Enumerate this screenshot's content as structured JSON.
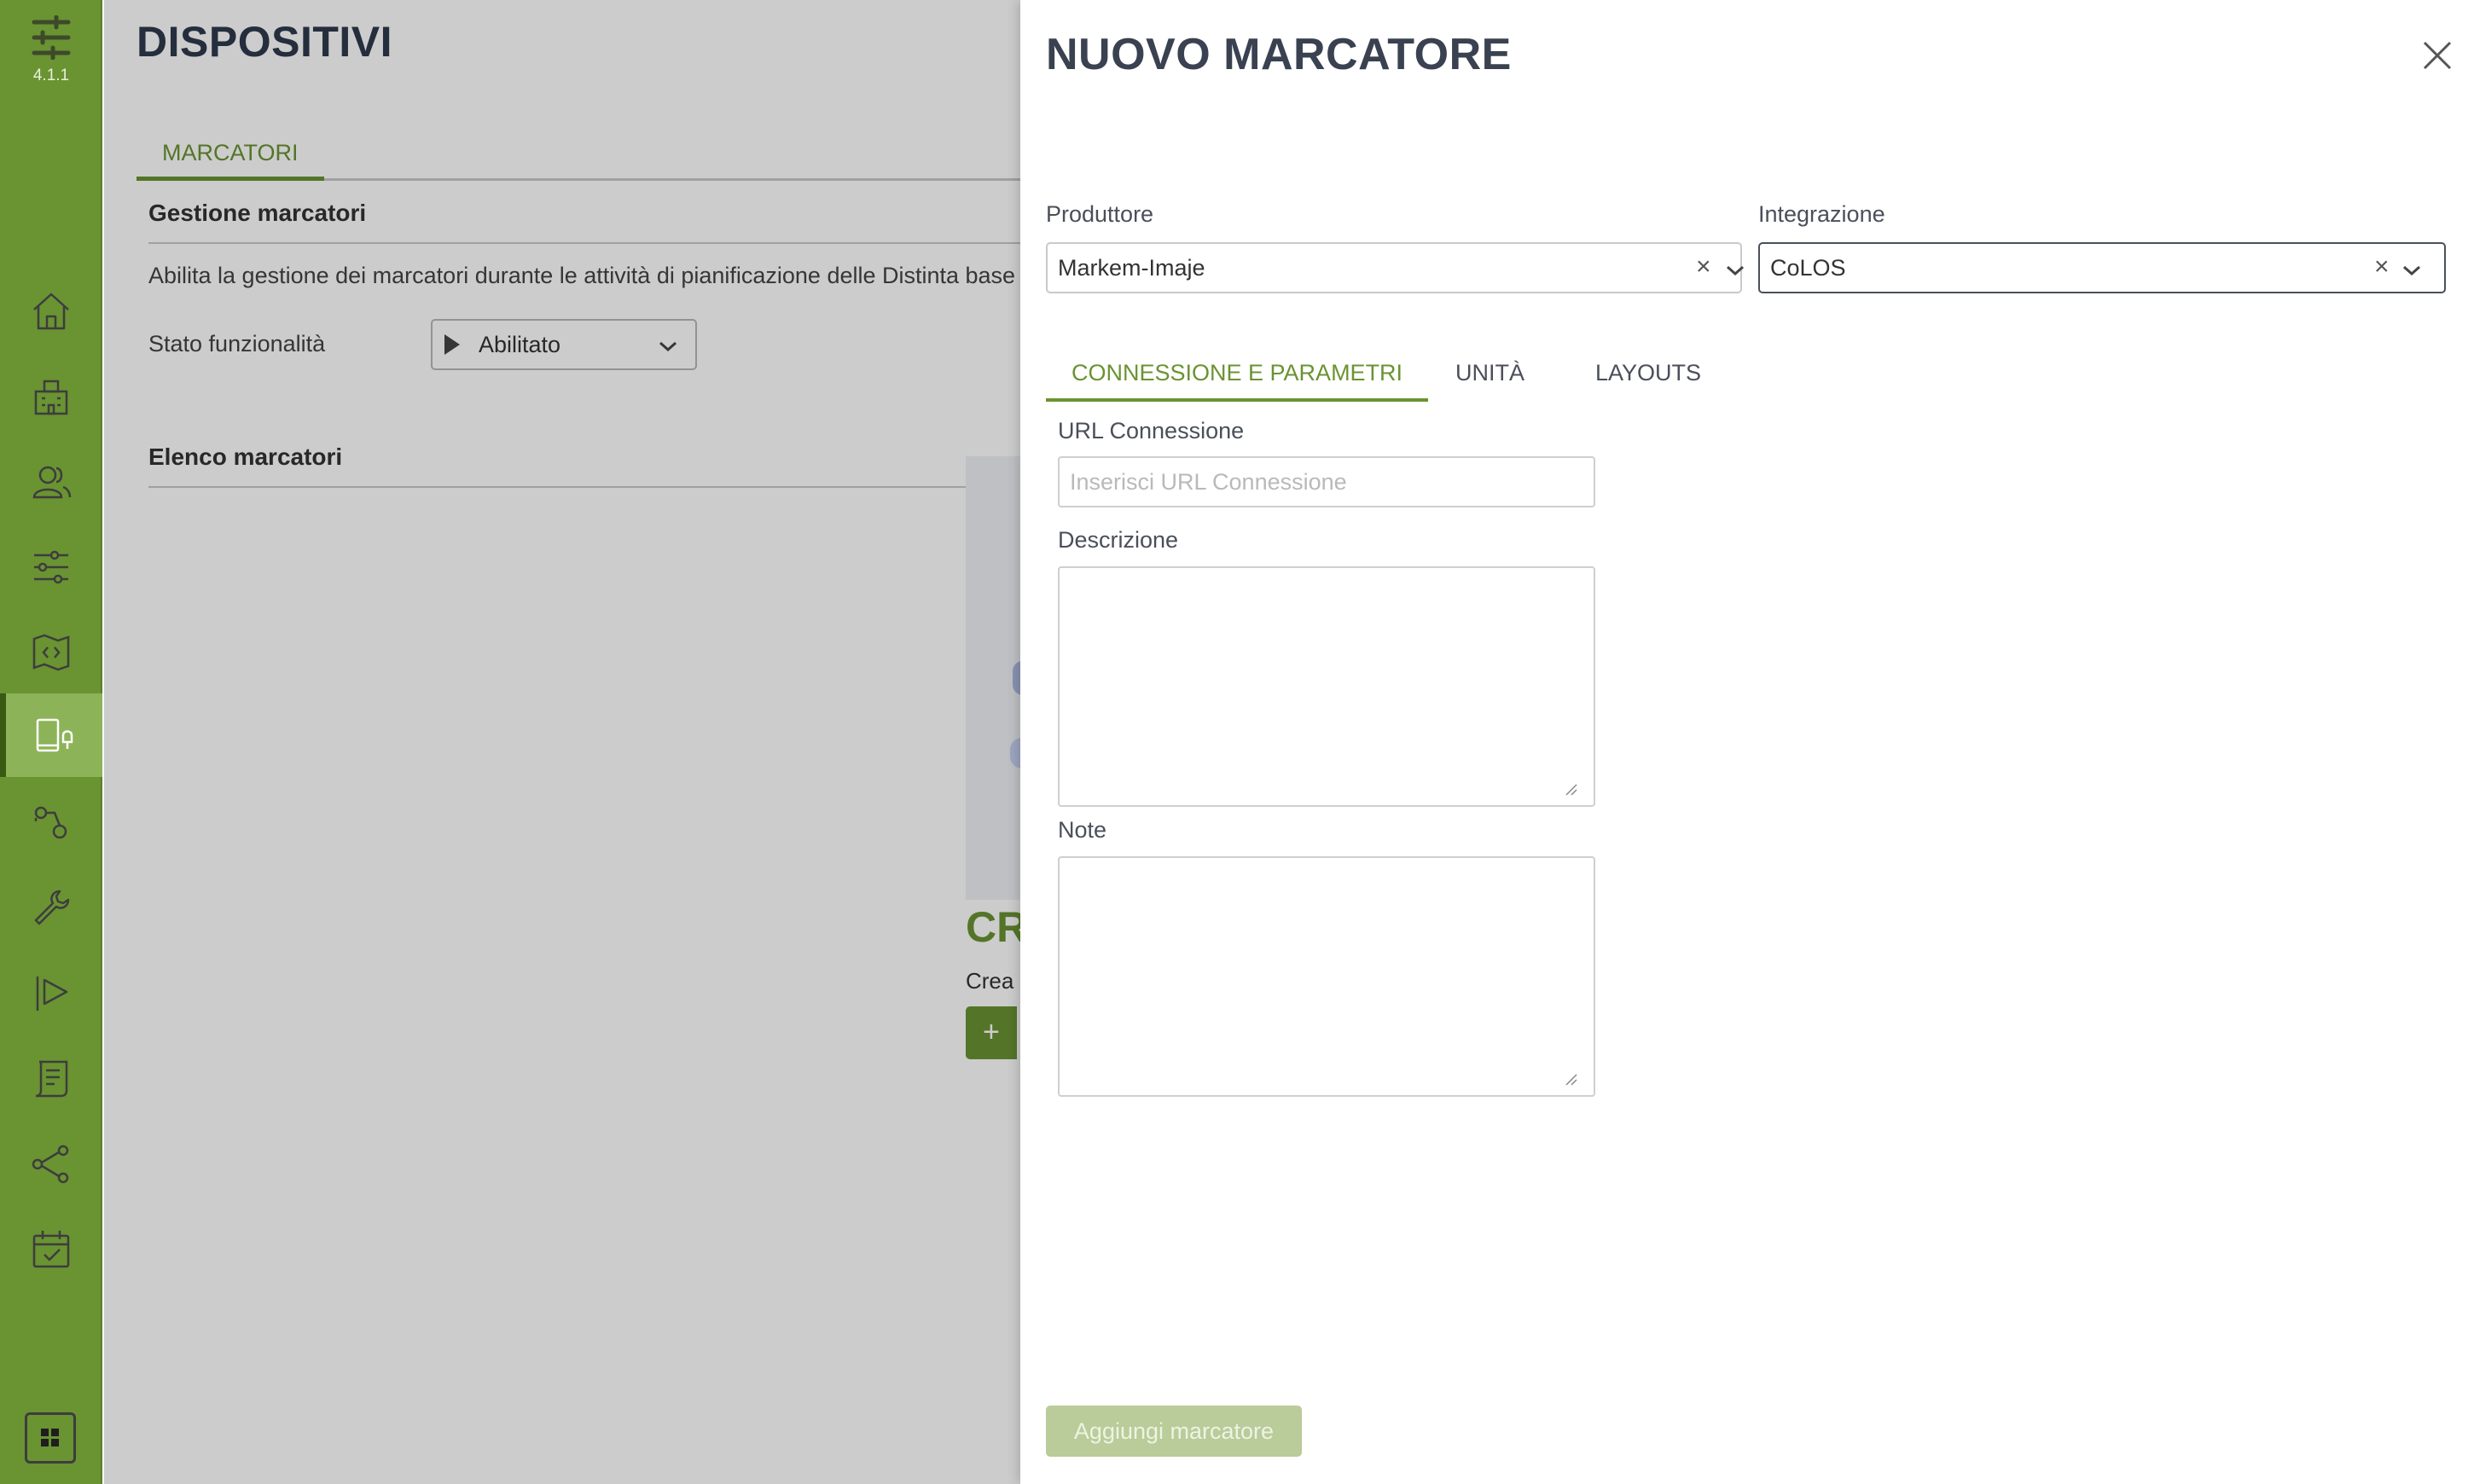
{
  "app": {
    "version": "4.1.1"
  },
  "page": {
    "title": "DISPOSITIVI",
    "tab_label": "MARCATORI",
    "section_management_title": "Gestione marcatori",
    "section_management_desc": "Abilita la gestione dei marcatori durante le attività di pianificazione delle Distinta base",
    "status_label": "Stato funzionalità",
    "status_value": "Abilitato",
    "section_list_title": "Elenco marcatori",
    "empty_title": "CR",
    "empty_sub": "Crea",
    "empty_button": "+"
  },
  "sidebar": {
    "items": [
      {
        "icon": "home-icon"
      },
      {
        "icon": "building-icon"
      },
      {
        "icon": "users-icon"
      },
      {
        "icon": "sliders-icon"
      },
      {
        "icon": "code-map-icon"
      },
      {
        "icon": "devices-icon",
        "active": true
      },
      {
        "icon": "process-icon"
      },
      {
        "icon": "wrench-icon"
      },
      {
        "icon": "play-flag-icon"
      },
      {
        "icon": "document-icon"
      },
      {
        "icon": "share-icon"
      },
      {
        "icon": "calendar-check-icon"
      }
    ]
  },
  "drawer": {
    "title": "NUOVO MARCATORE",
    "producer": {
      "label": "Produttore",
      "value": "Markem-Imaje"
    },
    "integration": {
      "label": "Integrazione",
      "value": "CoLOS"
    },
    "tabs": [
      {
        "label": "CONNESSIONE E PARAMETRI",
        "active": true
      },
      {
        "label": "UNITÀ",
        "active": false
      },
      {
        "label": "LAYOUTS",
        "active": false
      }
    ],
    "url": {
      "label": "URL Connessione",
      "placeholder": "Inserisci URL Connessione",
      "value": ""
    },
    "description": {
      "label": "Descrizione",
      "value": ""
    },
    "notes": {
      "label": "Note",
      "value": ""
    },
    "submit_label": "Aggiungi marcatore"
  },
  "colors": {
    "accent": "#6a9332",
    "sidebar": "#6a9332",
    "button_disabled": "#b9cc99"
  }
}
